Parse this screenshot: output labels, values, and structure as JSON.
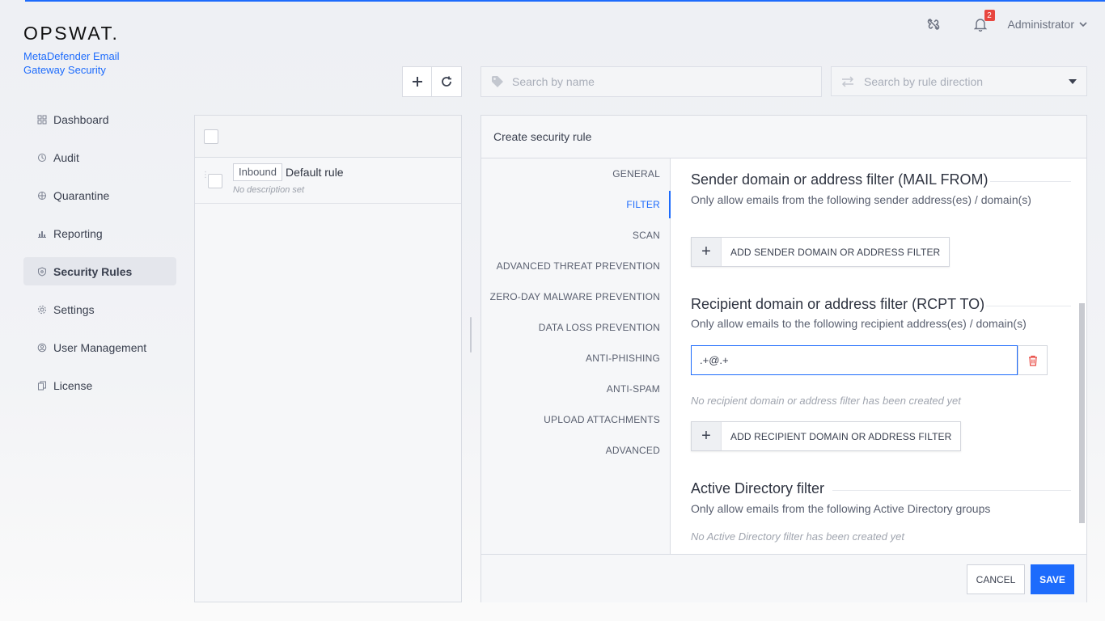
{
  "brand": {
    "logo_text": "OPSWAT.",
    "product_name": "MetaDefender Email Gateway Security"
  },
  "header": {
    "notifications_count": "2",
    "user_name": "Administrator"
  },
  "sidebar": {
    "items": [
      {
        "label": "Dashboard",
        "icon": "grid-icon"
      },
      {
        "label": "Audit",
        "icon": "audit-icon"
      },
      {
        "label": "Quarantine",
        "icon": "quarantine-icon"
      },
      {
        "label": "Reporting",
        "icon": "chart-icon"
      },
      {
        "label": "Security Rules",
        "icon": "shield-icon",
        "active": true
      },
      {
        "label": "Settings",
        "icon": "gear-icon"
      },
      {
        "label": "User Management",
        "icon": "user-icon"
      },
      {
        "label": "License",
        "icon": "license-icon"
      }
    ]
  },
  "search": {
    "name_placeholder": "Search by name",
    "direction_placeholder": "Search by rule direction"
  },
  "rules": [
    {
      "direction": "Inbound",
      "name": "Default rule",
      "description": "No description set"
    }
  ],
  "editor": {
    "title": "Create security rule",
    "tabs": [
      {
        "label": "GENERAL"
      },
      {
        "label": "FILTER",
        "active": true
      },
      {
        "label": "SCAN"
      },
      {
        "label": "ADVANCED THREAT PREVENTION"
      },
      {
        "label": "ZERO-DAY MALWARE PREVENTION"
      },
      {
        "label": "DATA LOSS PREVENTION"
      },
      {
        "label": "ANTI-PHISHING"
      },
      {
        "label": "ANTI-SPAM"
      },
      {
        "label": "UPLOAD ATTACHMENTS"
      },
      {
        "label": "ADVANCED"
      }
    ],
    "sender": {
      "title": "Sender domain or address filter (MAIL FROM)",
      "subtitle": "Only allow emails from the following sender address(es) / domain(s)",
      "add_label": "ADD SENDER DOMAIN OR ADDRESS FILTER"
    },
    "recipient": {
      "title": "Recipient domain or address filter (RCPT TO)",
      "subtitle": "Only allow emails to the following recipient address(es) / domain(s)",
      "filter_value": ".+@.+",
      "empty_note": "No recipient domain or address filter has been created yet",
      "add_label": "ADD RECIPIENT DOMAIN OR ADDRESS FILTER"
    },
    "active_directory": {
      "title": "Active Directory filter",
      "subtitle": "Only allow emails from the following Active Directory groups",
      "empty_note": "No Active Directory filter has been created yet"
    },
    "footer": {
      "cancel_label": "CANCEL",
      "save_label": "SAVE"
    }
  },
  "colors": {
    "accent": "#1d6bfc",
    "danger": "#e8463f"
  }
}
